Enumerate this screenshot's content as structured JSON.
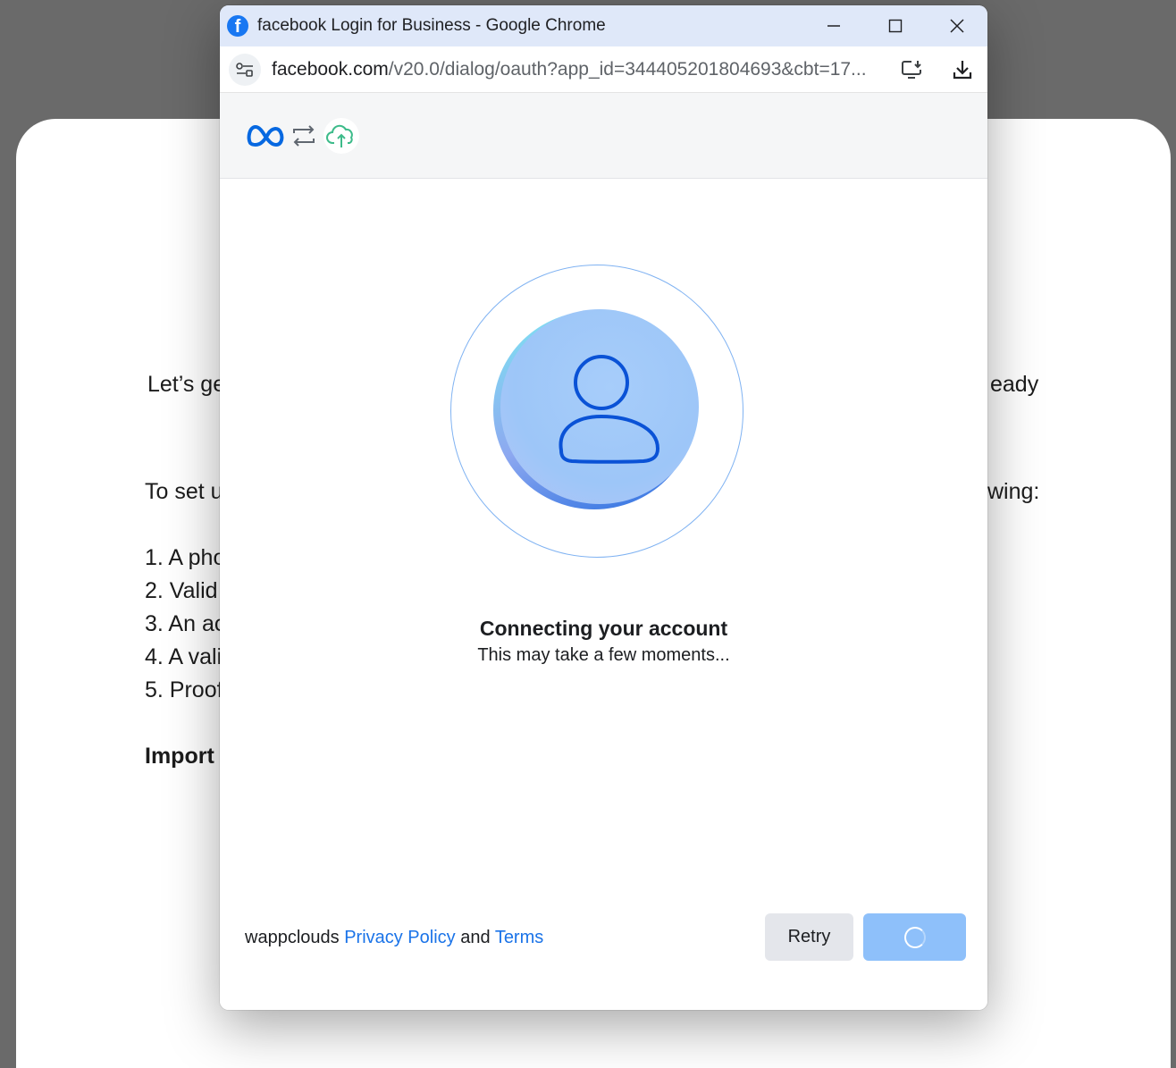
{
  "background_page": {
    "line1_left": "Let’s ge",
    "line1_right": "eady",
    "line2_left": "To set u",
    "line2_right": "wing:",
    "list": [
      "1. A pho",
      "2. Valid",
      "3. An ac",
      "4. A vali",
      "5. Proof"
    ],
    "important": "Import"
  },
  "window": {
    "title": "facebook Login for Business - Google Chrome",
    "url_domain": "facebook.com",
    "url_path": "/v20.0/dialog/oauth?app_id=344405201804693&cbt=17..."
  },
  "dialog": {
    "status_title": "Connecting your account",
    "status_subtitle": "This may take a few moments...",
    "footer": {
      "app_name": "wappclouds",
      "privacy_label": "Privacy Policy",
      "and_text": "and",
      "terms_label": "Terms"
    },
    "retry_label": "Retry"
  },
  "colors": {
    "meta_blue": "#0668e1",
    "link_blue": "#1a73e8",
    "primary_button": "#8ec0fa",
    "cloud_green": "#3dbb8a"
  }
}
